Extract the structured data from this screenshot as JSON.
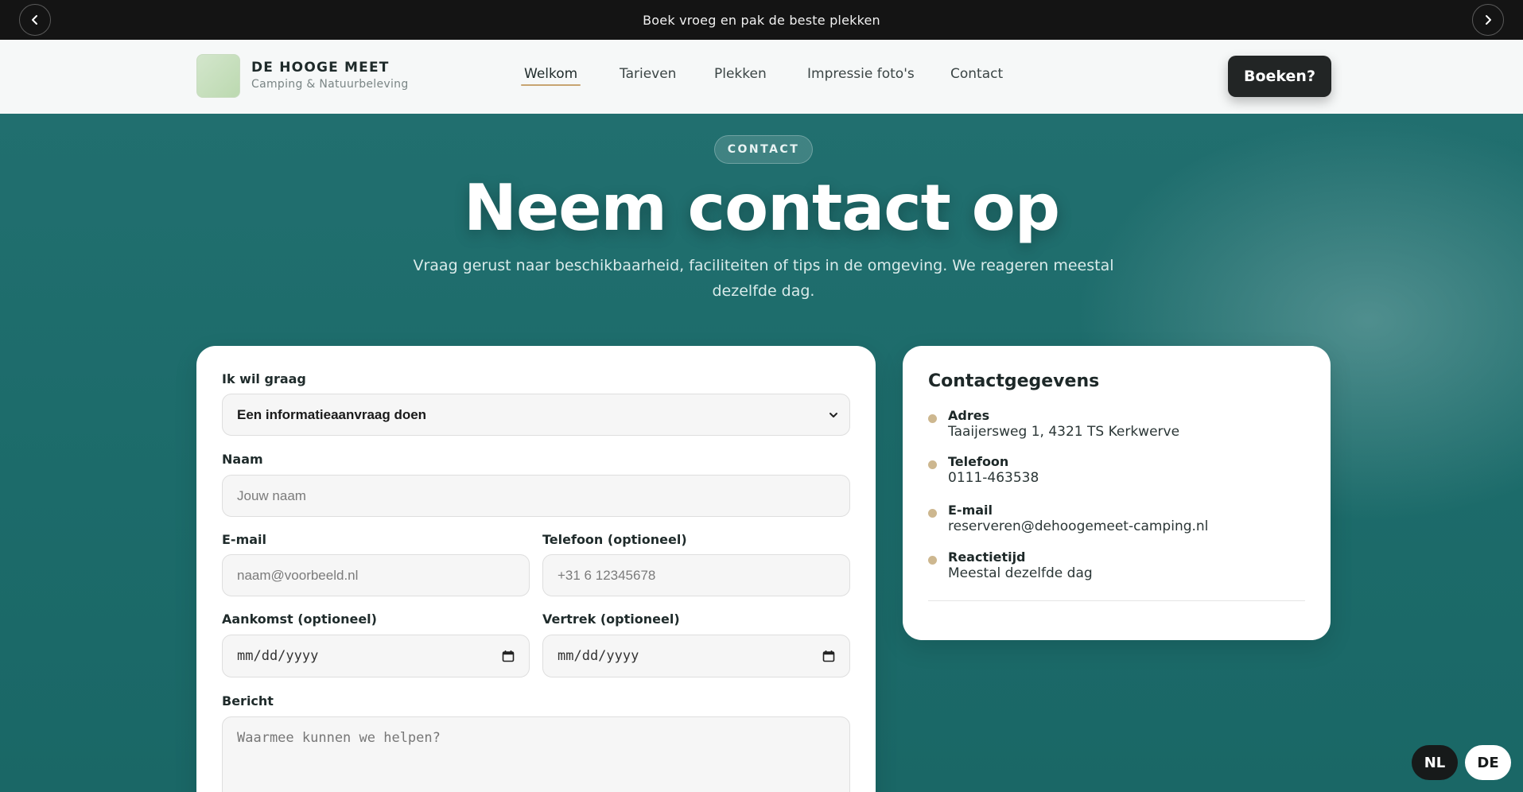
{
  "topbar": {
    "text": "Boek vroeg en pak de beste plekken"
  },
  "header": {
    "brand_name": "DE HOOGE MEET",
    "brand_sub": "Camping & Natuurbeleving",
    "nav": [
      "Welkom",
      "Tarieven",
      "Plekken",
      "Impressie foto's",
      "Contact"
    ],
    "active_nav": "Welkom",
    "cta": "Boeken?"
  },
  "hero": {
    "pill": "CONTACT",
    "title": "Neem contact op",
    "subtitle": "Vraag gerust naar beschikbaarheid, faciliteiten of tips in de omgeving. We reageren meestal dezelfde dag."
  },
  "form": {
    "request_label": "Ik wil graag",
    "request_value": "Een informatieaanvraag doen",
    "name_label": "Naam",
    "name_placeholder": "Jouw naam",
    "email_label": "E-mail",
    "email_placeholder": "naam@voorbeeld.nl",
    "phone_label": "Telefoon (optioneel)",
    "phone_placeholder": "+31 6 12345678",
    "arrival_label": "Aankomst (optioneel)",
    "arrival_placeholder": "mm/dd/yyyy",
    "departure_label": "Vertrek (optioneel)",
    "departure_placeholder": "mm/dd/yyyy",
    "message_label": "Bericht",
    "message_placeholder": "Waarmee kunnen we helpen?"
  },
  "contact": {
    "title": "Contactgegevens",
    "items": [
      {
        "label": "Adres",
        "value": "Taaijersweg 1, 4321 TS Kerkwerve"
      },
      {
        "label": "Telefoon",
        "value": "0111-463538"
      },
      {
        "label": "E-mail",
        "value": "reserveren@dehoogemeet-camping.nl"
      },
      {
        "label": "Reactietijd",
        "value": "Meestal dezelfde dag"
      }
    ]
  },
  "language": {
    "nl": "NL",
    "de": "DE",
    "selected": "NL"
  },
  "colors": {
    "hero_bg": "#1f6e6e",
    "accent": "#c7a572",
    "dark": "#222525",
    "dot": "#cdb78f"
  }
}
